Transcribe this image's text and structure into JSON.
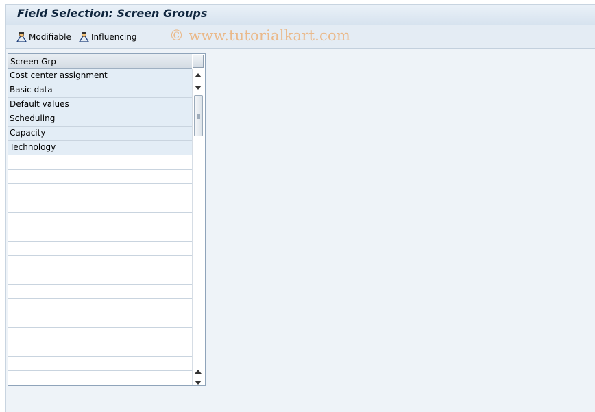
{
  "window": {
    "title": "Field Selection: Screen Groups"
  },
  "toolbar": {
    "modifiable_label": "Modifiable",
    "influencing_label": "Influencing"
  },
  "watermark": "© www.tutorialkart.com",
  "table": {
    "column_header": "Screen Grp",
    "rows": [
      "Cost center assignment",
      "Basic data",
      "Default values",
      "Scheduling",
      "Capacity",
      "Technology"
    ]
  },
  "icons": {
    "modifiable": "person-hat-icon",
    "influencing": "person-hat-icon"
  },
  "colors": {
    "background": "#eef3f8",
    "title_text": "#10263e",
    "row_fill": "#e3edf6",
    "watermark": "#eab98a"
  }
}
